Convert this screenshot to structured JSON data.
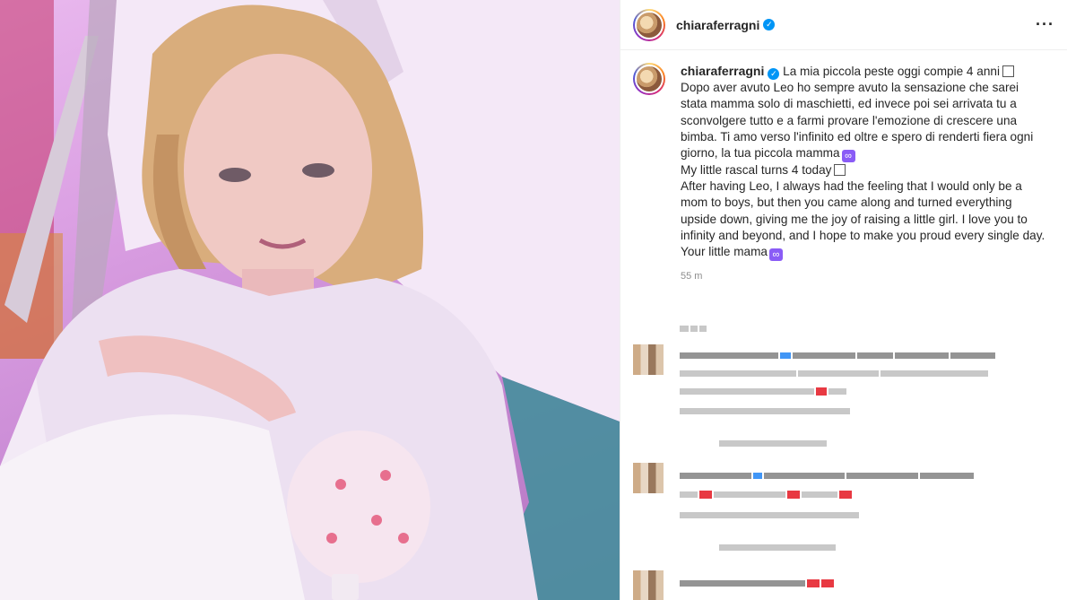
{
  "post": {
    "username": "chiaraferragni",
    "more_icon": "more-options-icon",
    "caption": {
      "it_line1": "La mia piccola peste oggi compie 4 anni",
      "it_body": "Dopo aver avuto Leo ho sempre avuto la sensazione che sarei stata mamma solo di maschietti, ed invece poi sei arrivata tu a sconvolgere tutto e a farmi provare l'emozione di crescere una bimba. Ti amo verso l'infinito ed oltre e spero di renderti fiera ogni giorno, la tua piccola mamma",
      "en_line1": "My little rascal turns 4 today",
      "en_body": "After having Leo, I always had the feeling that I would only be a mom to boys, but then you came along and turned everything upside down, giving me the joy of raising a little girl. I love you to infinity and beyond, and I hope to make you proud every single day.",
      "en_sign": "Your little mama"
    },
    "time": "55 m"
  },
  "icons": {
    "verified": "verified-badge-icon",
    "infinity": "infinity-emoji",
    "placeholder": "emoji-placeholder-icon"
  },
  "colors": {
    "verified": "#0095f6",
    "meta_text": "#8e8e8e"
  }
}
